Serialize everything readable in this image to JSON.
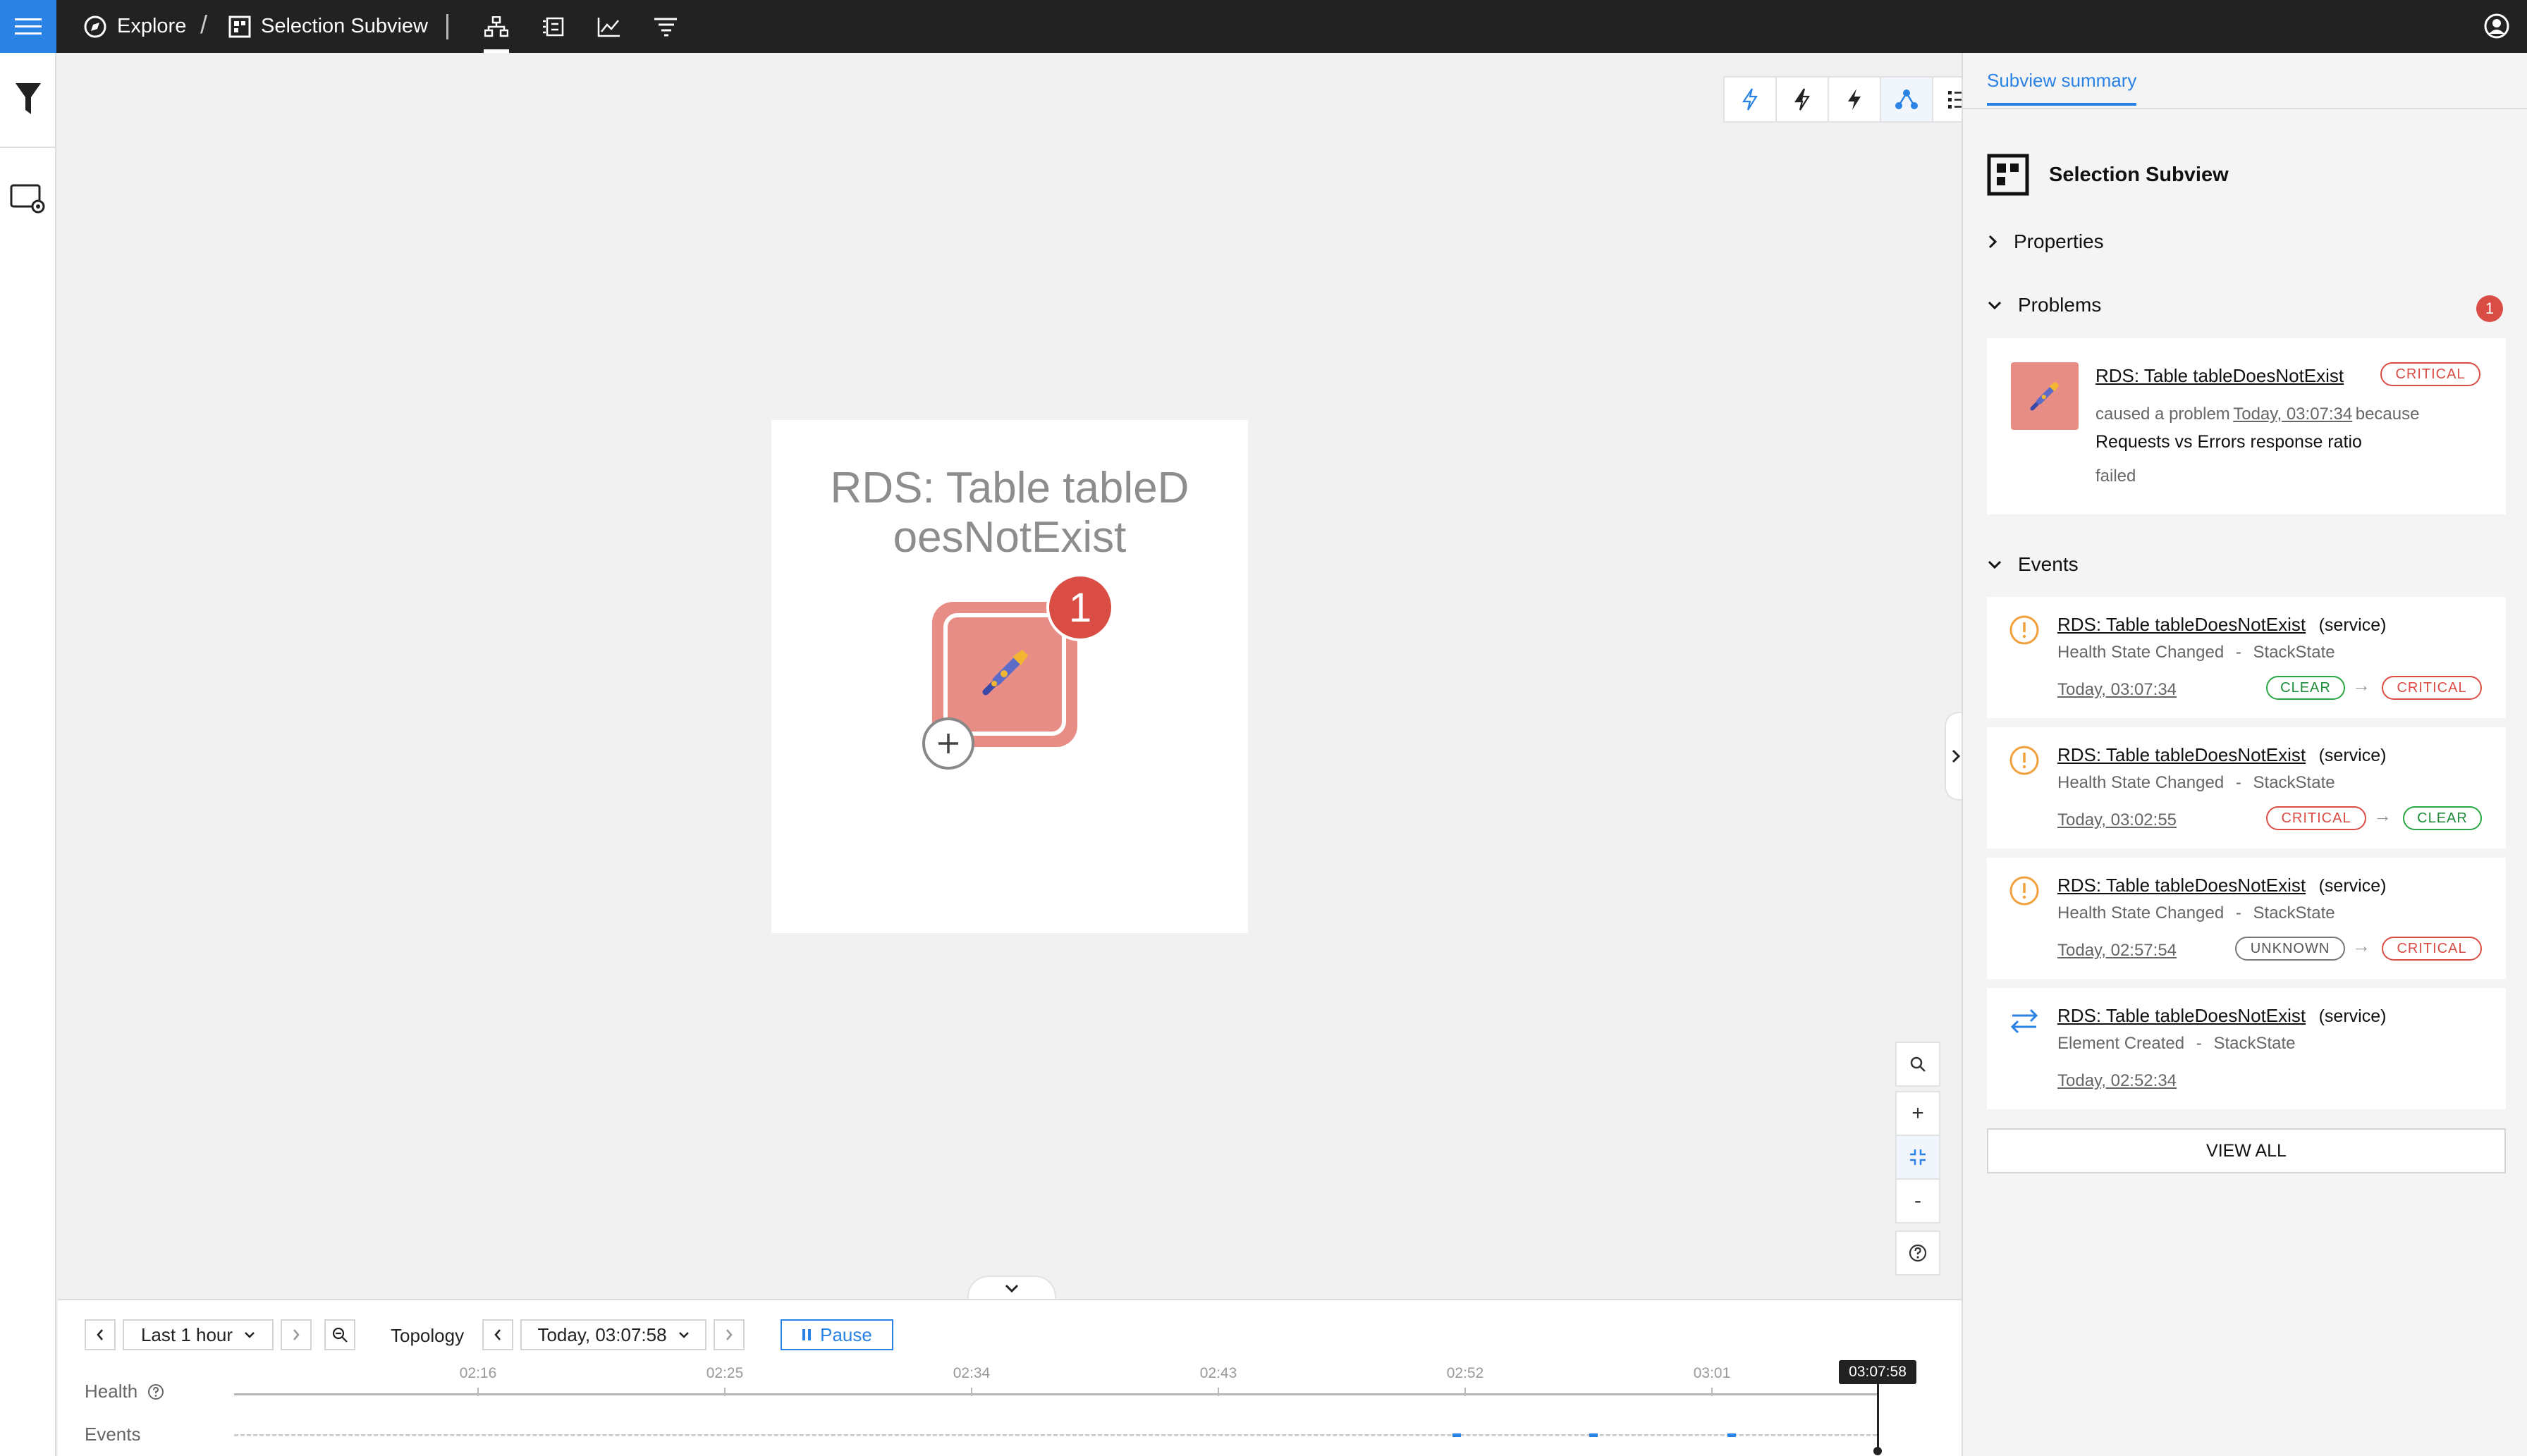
{
  "topbar": {
    "explore_label": "Explore",
    "view_label": "Selection Subview"
  },
  "canvas": {
    "node": {
      "title": "RDS: Table tableD\noesNotExist",
      "badge": "1"
    },
    "zoom": {
      "plus": "+",
      "minus": "-"
    }
  },
  "timeline": {
    "range_label": "Last 1 hour",
    "topology_label": "Topology",
    "time_label": "Today, 03:07:58",
    "pause_label": "Pause",
    "health_label": "Health",
    "events_label": "Events",
    "ticks": [
      "02:16",
      "02:25",
      "02:34",
      "02:43",
      "02:52",
      "03:01"
    ],
    "cursor_time": "03:07:58"
  },
  "panel": {
    "tab": "Subview summary",
    "title": "Selection Subview",
    "properties_label": "Properties",
    "problems_label": "Problems",
    "problems_count": "1",
    "problem": {
      "component": "RDS: Table tableDoesNotExist",
      "state": "CRITICAL",
      "line1_a": "caused a problem",
      "line1_time": "Today, 03:07:34",
      "line1_b": "because",
      "check": "Requests vs Errors response ratio",
      "result": "failed"
    },
    "events_label": "Events",
    "events": [
      {
        "name": "RDS: Table tableDoesNotExist",
        "type": "(service)",
        "kind": "Health State Changed",
        "sep": "-",
        "source": "StackState",
        "time": "Today, 03:07:34",
        "from": "CLEAR",
        "to": "CRITICAL"
      },
      {
        "name": "RDS: Table tableDoesNotExist",
        "type": "(service)",
        "kind": "Health State Changed",
        "sep": "-",
        "source": "StackState",
        "time": "Today, 03:02:55",
        "from": "CRITICAL",
        "to": "CLEAR"
      },
      {
        "name": "RDS: Table tableDoesNotExist",
        "type": "(service)",
        "kind": "Health State Changed",
        "sep": "-",
        "source": "StackState",
        "time": "Today, 02:57:54",
        "from": "UNKNOWN",
        "to": "CRITICAL"
      },
      {
        "name": "RDS: Table tableDoesNotExist",
        "type": "(service)",
        "kind": "Element Created",
        "sep": "-",
        "source": "StackState",
        "time": "Today, 02:52:34"
      }
    ],
    "view_all": "VIEW ALL"
  },
  "colors": {
    "accent": "#2a82e4",
    "critical": "#d94d44",
    "clear": "#28a745",
    "node_fill": "#e88d86",
    "topbar": "#222222"
  }
}
